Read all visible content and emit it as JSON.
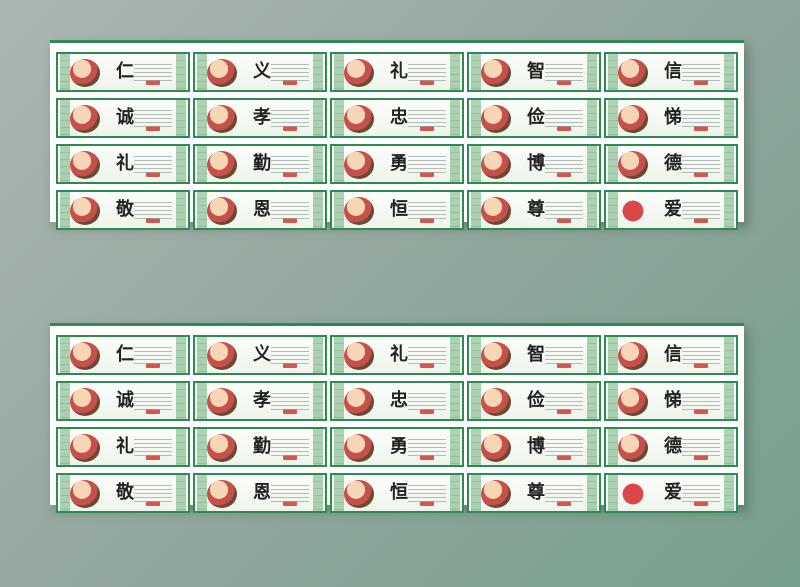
{
  "boards": [
    {
      "panels": [
        {
          "char": "仁"
        },
        {
          "char": "义"
        },
        {
          "char": "礼"
        },
        {
          "char": "智"
        },
        {
          "char": "信"
        },
        {
          "char": "诚"
        },
        {
          "char": "孝"
        },
        {
          "char": "忠"
        },
        {
          "char": "俭"
        },
        {
          "char": "悌"
        },
        {
          "char": "礼"
        },
        {
          "char": "勤"
        },
        {
          "char": "勇"
        },
        {
          "char": "博"
        },
        {
          "char": "德"
        },
        {
          "char": "敬"
        },
        {
          "char": "恩"
        },
        {
          "char": "恒"
        },
        {
          "char": "尊"
        },
        {
          "char": "爱"
        }
      ]
    },
    {
      "panels": [
        {
          "char": "仁"
        },
        {
          "char": "义"
        },
        {
          "char": "礼"
        },
        {
          "char": "智"
        },
        {
          "char": "信"
        },
        {
          "char": "诚"
        },
        {
          "char": "孝"
        },
        {
          "char": "忠"
        },
        {
          "char": "俭"
        },
        {
          "char": "悌"
        },
        {
          "char": "礼"
        },
        {
          "char": "勤"
        },
        {
          "char": "勇"
        },
        {
          "char": "博"
        },
        {
          "char": "德"
        },
        {
          "char": "敬"
        },
        {
          "char": "恩"
        },
        {
          "char": "恒"
        },
        {
          "char": "尊"
        },
        {
          "char": "爱"
        }
      ]
    }
  ]
}
